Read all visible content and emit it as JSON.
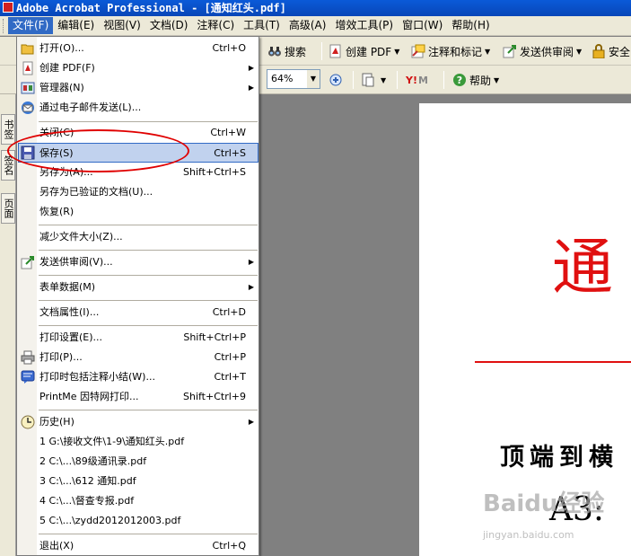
{
  "window": {
    "title": "Adobe Acrobat Professional - [通知红头.pdf]"
  },
  "menubar": {
    "items": [
      "文件(F)",
      "编辑(E)",
      "视图(V)",
      "文档(D)",
      "注释(C)",
      "工具(T)",
      "高级(A)",
      "增效工具(P)",
      "窗口(W)",
      "帮助(H)"
    ]
  },
  "toolbar": {
    "search": "搜索",
    "create_pdf": "创建 PDF",
    "comment": "注释和标记",
    "send_review": "发送供审阅",
    "security": "安全",
    "zoom": "64%",
    "help": "帮助"
  },
  "navpanel": {
    "tabs": [
      "书签",
      "签名",
      "页面"
    ]
  },
  "file_menu": {
    "items": [
      {
        "label": "打开(O)...",
        "shortcut": "Ctrl+O",
        "icon": "open-folder-icon"
      },
      {
        "label": "创建 PDF(F)",
        "shortcut": "",
        "icon": "create-pdf-icon"
      },
      {
        "label": "管理器(N)",
        "shortcut": "",
        "icon": "organizer-icon"
      },
      {
        "label": "通过电子邮件发送(L)...",
        "shortcut": "",
        "icon": "email-icon"
      },
      {
        "label": "关闭(C)",
        "shortcut": "Ctrl+W",
        "icon": ""
      },
      {
        "label": "保存(S)",
        "shortcut": "Ctrl+S",
        "icon": "save-disk-icon"
      },
      {
        "label": "另存为(A)...",
        "shortcut": "Shift+Ctrl+S",
        "icon": ""
      },
      {
        "label": "另存为已验证的文档(U)...",
        "shortcut": "",
        "icon": ""
      },
      {
        "label": "恢复(R)",
        "shortcut": "",
        "icon": ""
      },
      {
        "label": "减少文件大小(Z)...",
        "shortcut": "",
        "icon": ""
      },
      {
        "label": "发送供审阅(V)...",
        "shortcut": "",
        "icon": "send-review-icon"
      },
      {
        "label": "表单数据(M)",
        "shortcut": "",
        "icon": ""
      },
      {
        "label": "文档属性(I)...",
        "shortcut": "Ctrl+D",
        "icon": ""
      },
      {
        "label": "打印设置(E)...",
        "shortcut": "Shift+Ctrl+P",
        "icon": ""
      },
      {
        "label": "打印(P)...",
        "shortcut": "Ctrl+P",
        "icon": "printer-icon"
      },
      {
        "label": "打印时包括注释小结(W)...",
        "shortcut": "Ctrl+T",
        "icon": "comment-summary-icon"
      },
      {
        "label": "PrintMe 因特网打印...",
        "shortcut": "Shift+Ctrl+9",
        "icon": ""
      },
      {
        "label": "历史(H)",
        "shortcut": "",
        "icon": "history-clock-icon"
      },
      {
        "label": "1 G:\\接收文件\\1-9\\通知红头.pdf",
        "shortcut": "",
        "icon": ""
      },
      {
        "label": "2 C:\\...\\89级通讯录.pdf",
        "shortcut": "",
        "icon": ""
      },
      {
        "label": "3 C:\\...\\612 通知.pdf",
        "shortcut": "",
        "icon": ""
      },
      {
        "label": "4 C:\\...\\督查专报.pdf",
        "shortcut": "",
        "icon": ""
      },
      {
        "label": "5 C:\\...\\zydd2012012003.pdf",
        "shortcut": "",
        "icon": ""
      },
      {
        "label": "退出(X)",
        "shortcut": "Ctrl+Q",
        "icon": ""
      }
    ]
  },
  "document": {
    "header_char": "通",
    "line2": "顶端到横",
    "line3": "A3:"
  },
  "watermark": {
    "text": "Baidu经验",
    "sub": "jingyan.baidu.com"
  },
  "colors": {
    "accent": "#316ac5",
    "red_header": "#e01010",
    "annotation": "#e00000"
  }
}
